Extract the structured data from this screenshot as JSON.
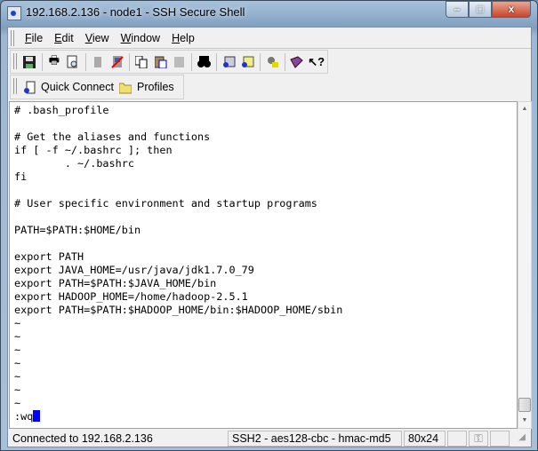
{
  "window": {
    "title": "192.168.2.136 - node1 - SSH Secure Shell",
    "minimize": "–",
    "maximize": "□",
    "close": "x"
  },
  "menu": [
    {
      "first": "F",
      "rest": "ile"
    },
    {
      "first": "E",
      "rest": "dit"
    },
    {
      "first": "V",
      "rest": "iew"
    },
    {
      "first": "W",
      "rest": "indow"
    },
    {
      "first": "H",
      "rest": "elp"
    }
  ],
  "toolbar": {
    "icons": [
      "save-icon",
      "print-icon",
      "print-preview-icon",
      "disabled-icon",
      "disconnect-icon",
      "copy-icon",
      "paste-icon",
      "paste-disabled-icon",
      "find-icon",
      "new-terminal-icon",
      "new-file-transfer-icon",
      "settings-icon",
      "help-book-icon",
      "context-help-icon"
    ]
  },
  "quickbar": {
    "quick_connect": "Quick Connect",
    "profiles": "Profiles"
  },
  "terminal": {
    "lines": [
      "# .bash_profile",
      "",
      "# Get the aliases and functions",
      "if [ -f ~/.bashrc ]; then",
      "        . ~/.bashrc",
      "fi",
      "",
      "# User specific environment and startup programs",
      "",
      "PATH=$PATH:$HOME/bin",
      "",
      "export PATH",
      "export JAVA_HOME=/usr/java/jdk1.7.0_79",
      "export PATH=$PATH:$JAVA_HOME/bin",
      "export HADOOP_HOME=/home/hadoop-2.5.1",
      "export PATH=$PATH:$HADOOP_HOME/bin:$HADOOP_HOME/sbin",
      "~",
      "~",
      "~",
      "~",
      "~",
      "~",
      "~"
    ],
    "command": ":wq",
    "cursor_color": "#0000ff"
  },
  "status": {
    "connection": "Connected to 192.168.2.136",
    "cipher": "SSH2 - aes128-cbc - hmac-md5",
    "size": "80x24"
  }
}
